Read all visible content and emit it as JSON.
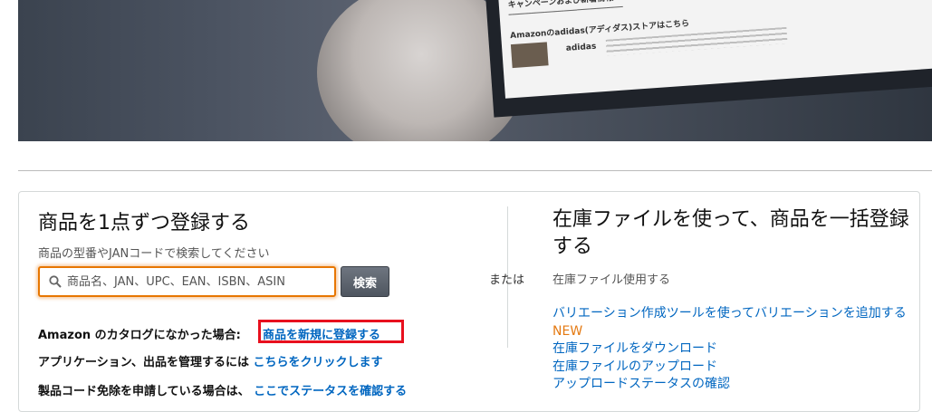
{
  "hero": {
    "screen_campaign": "キャンペーンおよび新着情報",
    "screen_store": "Amazonのadidas(アディダス)ストアはこちら",
    "screen_brand": "adidas"
  },
  "single": {
    "title": "商品を1点ずつ登録する",
    "subtitle": "商品の型番やJANコードで検索してください",
    "search_placeholder": "商品名、JAN、UPC、EAN、ISBN、ASIN",
    "search_button": "検索",
    "catalog_label": "Amazon のカタログになかった場合:",
    "catalog_link": "商品を新規に登録する",
    "manage_label": "アプリケーション、出品を管理するには",
    "manage_link": "こちらをクリックします",
    "exemption_label": "製品コード免除を申請している場合は、",
    "exemption_link": "ここでステータスを確認する"
  },
  "separator_label": "または",
  "bulk": {
    "title": "在庫ファイルを使って、商品を一括登録する",
    "subtitle": "在庫ファイル使用する",
    "links": {
      "variation": "バリエーション作成ツールを使ってバリエーションを追加する",
      "new_badge": "NEW",
      "download": "在庫ファイルをダウンロード",
      "upload": "在庫ファイルのアップロード",
      "upload_status": "アップロードステータスの確認"
    }
  },
  "colors": {
    "link": "#0066c0",
    "search_focus": "#e77600",
    "highlight_box": "#e8101e",
    "new_badge": "#e47911"
  }
}
